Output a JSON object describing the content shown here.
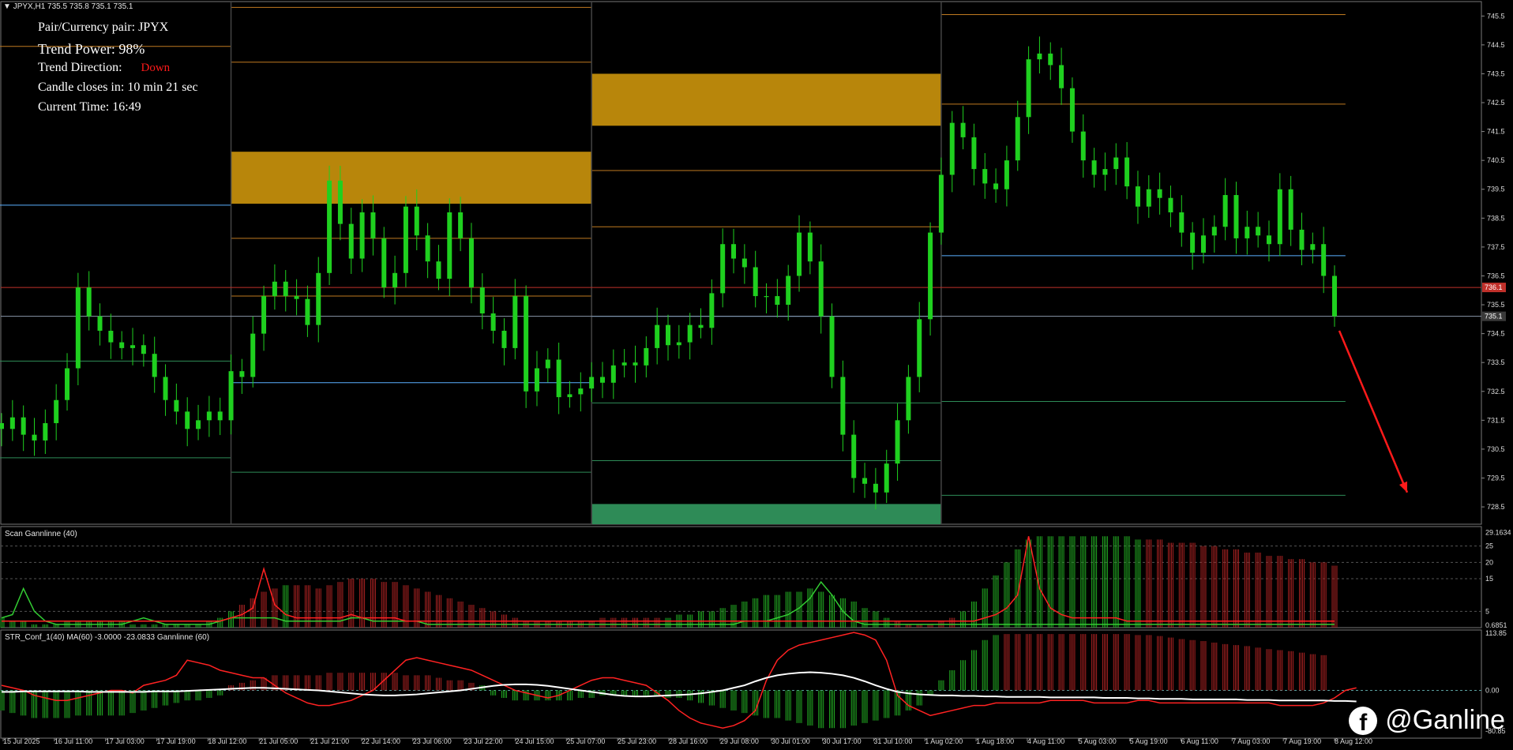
{
  "chart_header": {
    "symbol_line": "JPYX,H1  735.5 735.8 735.1 735.1",
    "scan_title": "Scan  Gannlinne (40)",
    "str_title": "STR_Conf_1(40) MA(60) -3.0000 -23.0833  Gannlinne (60)"
  },
  "info_panel": {
    "pair_label": "Pair/Currency pair: JPYX",
    "trend_power": "Trend Power: 98%",
    "trend_direction_label": "Trend Direction:",
    "trend_direction_value": "Down",
    "candle_close": "Candle closes in: 10 min 21 sec",
    "current_time": "Current Time: 16:49"
  },
  "brand": {
    "handle": "@Ganline",
    "icon": "facebook-icon"
  },
  "colors": {
    "candle": "#1fd01f",
    "zone": "#b8860b",
    "support_zone": "#2e8b57",
    "bull_hist": "#22aa22",
    "bear_hist": "#aa2222",
    "arrow": "#ff1a1a"
  },
  "chart_data": {
    "type": "candlestick",
    "main": {
      "y_ticks": [
        "745.5",
        "744.5",
        "743.5",
        "742.5",
        "741.5",
        "740.5",
        "739.5",
        "738.5",
        "737.5",
        "736.5",
        "735.5",
        "734.5",
        "733.5",
        "732.5",
        "731.5",
        "730.5",
        "729.5",
        "728.5"
      ],
      "ylim": [
        727.9,
        746.0
      ],
      "price_tags": [
        "736.1",
        "735.1"
      ],
      "last_price": 735.1,
      "ref_price": 736.1,
      "arrow_from": 734.6,
      "arrow_to": 729.0,
      "closes": [
        731.2,
        731.6,
        731.0,
        730.8,
        731.4,
        732.2,
        733.3,
        736.1,
        735.1,
        734.6,
        734.2,
        734.0,
        734.1,
        733.8,
        733.0,
        732.2,
        731.8,
        731.2,
        731.5,
        731.8,
        731.5,
        733.2,
        733.0,
        734.5,
        735.8,
        736.3,
        735.8,
        735.7,
        734.8,
        736.6,
        739.8,
        738.3,
        737.1,
        738.7,
        737.8,
        736.1,
        736.6,
        738.9,
        737.9,
        737.0,
        736.4,
        738.7,
        737.8,
        736.1,
        735.2,
        734.6,
        734.0,
        735.8,
        732.5,
        733.3,
        733.6,
        732.3,
        732.4,
        732.6,
        733.0,
        732.8,
        733.4,
        733.5,
        733.4,
        734.0,
        734.8,
        734.1,
        734.2,
        734.8,
        734.7,
        735.9,
        737.6,
        737.1,
        736.8,
        735.8,
        735.8,
        735.5,
        736.5,
        738.0,
        737.0,
        735.1,
        733.0,
        731.0,
        729.5,
        729.3,
        729.0,
        730.0,
        731.5,
        733.0,
        735.0,
        738.0,
        740.0,
        741.8,
        741.3,
        740.2,
        739.7,
        739.5,
        740.5,
        742.0,
        744.0,
        744.2,
        743.8,
        743.0,
        741.5,
        740.5,
        740.0,
        740.2,
        740.6,
        739.6,
        738.9,
        739.5,
        739.2,
        738.7,
        738.0,
        737.3,
        737.9,
        738.2,
        739.3,
        737.8,
        738.2,
        737.9,
        737.6,
        739.5,
        738.1,
        737.4,
        737.6,
        736.5,
        735.1
      ],
      "segments": [
        {
          "x0": 0,
          "x1": 21,
          "lines": [
            {
              "p": 744.45,
              "c": "#c07a20"
            },
            {
              "p": 738.95,
              "c": "#5ab0ff"
            },
            {
              "p": 733.55,
              "c": "#2e8b57"
            },
            {
              "p": 730.2,
              "c": "#2e8b57"
            }
          ]
        },
        {
          "x0": 21,
          "x1": 54,
          "zone": [
            739.0,
            740.8
          ],
          "lines": [
            {
              "p": 745.8,
              "c": "#c07a20"
            },
            {
              "p": 743.9,
              "c": "#c07a20"
            },
            {
              "p": 737.8,
              "c": "#c07a20"
            },
            {
              "p": 735.8,
              "c": "#c07a20"
            },
            {
              "p": 732.8,
              "c": "#5ab0ff"
            },
            {
              "p": 729.7,
              "c": "#2e8b57"
            }
          ]
        },
        {
          "x0": 54,
          "x1": 86,
          "zone": [
            741.7,
            743.5
          ],
          "support": [
            727.9,
            728.6
          ],
          "lines": [
            {
              "p": 740.15,
              "c": "#c07a20"
            },
            {
              "p": 738.2,
              "c": "#c07a20"
            },
            {
              "p": 735.1,
              "c": "#5ab0ff"
            },
            {
              "p": 732.1,
              "c": "#2e8b57"
            },
            {
              "p": 730.1,
              "c": "#2e8b57"
            }
          ]
        },
        {
          "x0": 86,
          "x1": 123,
          "lines": [
            {
              "p": 745.55,
              "c": "#c07a20"
            },
            {
              "p": 742.45,
              "c": "#c07a20"
            },
            {
              "p": 737.2,
              "c": "#5ab0ff"
            },
            {
              "p": 732.15,
              "c": "#2e8b57"
            },
            {
              "p": 728.9,
              "c": "#2e8b57"
            }
          ]
        }
      ]
    },
    "scan": {
      "y_ticks": [
        "29.1634",
        "25",
        "20",
        "15",
        "5",
        "0.6851"
      ],
      "ylim": [
        0,
        30
      ],
      "hist": [
        3,
        2,
        2,
        1,
        1,
        1,
        2,
        2,
        2,
        2,
        2,
        2,
        1,
        1,
        1,
        1,
        1,
        1,
        1,
        2,
        3,
        5,
        7,
        9,
        11,
        12,
        13,
        13,
        13,
        12,
        13,
        14,
        15,
        15,
        15,
        14,
        14,
        13,
        12,
        11,
        10,
        9,
        8,
        7,
        6,
        5,
        4,
        3,
        2,
        2,
        2,
        2,
        2,
        2,
        2,
        3,
        3,
        3,
        3,
        3,
        3,
        3,
        4,
        4,
        5,
        5,
        6,
        7,
        8,
        9,
        10,
        10,
        11,
        11,
        12,
        11,
        10,
        9,
        8,
        6,
        5,
        3,
        2,
        1,
        1,
        1,
        2,
        3,
        5,
        8,
        12,
        16,
        20,
        24,
        27,
        28,
        28,
        28,
        28,
        28,
        28,
        28,
        28,
        28,
        27,
        27,
        27,
        26,
        26,
        26,
        25,
        25,
        24,
        24,
        23,
        23,
        22,
        22,
        21,
        21,
        20,
        20,
        19
      ],
      "hist_colors": "ggggggggggggggggggggggrrrrgrrrrrrrrrrrrrrrrrrrrrrrrrrrrrrrrrrgggggggggggggggggggggrrrrrrgggggggggggggggggrrrrrrrrrrrrrrrrrrrrrrrrrrrrrrr",
      "green_line": [
        3,
        4,
        12,
        5,
        2,
        1,
        1,
        1,
        1,
        1,
        1,
        1,
        2,
        3,
        2,
        1,
        1,
        1,
        1,
        1,
        2,
        3,
        3,
        3,
        3,
        3,
        2,
        2,
        2,
        2,
        2,
        2,
        3,
        3,
        2,
        2,
        2,
        2,
        2,
        1,
        1,
        1,
        1,
        1,
        1,
        1,
        1,
        1,
        1,
        1,
        1,
        1,
        1,
        1,
        1,
        1,
        1,
        1,
        1,
        1,
        1,
        1,
        1,
        1,
        1,
        1,
        1,
        1,
        2,
        2,
        2,
        3,
        4,
        6,
        9,
        14,
        10,
        5,
        2,
        1,
        1,
        1,
        1,
        1,
        1,
        1,
        1,
        1,
        1,
        1,
        1,
        1,
        1,
        1,
        1,
        1,
        1,
        1,
        1,
        1,
        1,
        1,
        1,
        1,
        1,
        1,
        1,
        1,
        1,
        1,
        1,
        1,
        1,
        1,
        1,
        1,
        1,
        1,
        1,
        1,
        1,
        1,
        1
      ],
      "red_line": [
        2,
        2,
        2,
        2,
        2,
        2,
        2,
        2,
        2,
        2,
        2,
        2,
        2,
        2,
        2,
        2,
        2,
        2,
        2,
        2,
        2,
        3,
        4,
        6,
        18,
        7,
        4,
        3,
        3,
        3,
        3,
        3,
        4,
        3,
        3,
        3,
        3,
        2,
        2,
        2,
        2,
        2,
        2,
        2,
        2,
        2,
        2,
        2,
        2,
        2,
        2,
        2,
        2,
        2,
        2,
        2,
        2,
        2,
        2,
        2,
        2,
        2,
        2,
        2,
        2,
        2,
        2,
        2,
        2,
        2,
        2,
        2,
        2,
        2,
        2,
        2,
        2,
        2,
        2,
        2,
        2,
        2,
        2,
        2,
        2,
        2,
        2,
        2,
        2,
        2,
        3,
        4,
        6,
        10,
        28,
        12,
        6,
        4,
        3,
        3,
        3,
        3,
        3,
        2,
        2,
        2,
        2,
        2,
        2,
        2,
        2,
        2,
        2,
        2,
        2,
        2,
        2,
        2,
        2,
        2,
        2,
        2,
        2
      ]
    },
    "str": {
      "y_ticks": [
        "113.85",
        "0.00",
        "-80.85"
      ],
      "ylim": [
        -95,
        120
      ],
      "hist": [
        -40,
        -45,
        -50,
        -55,
        -55,
        -55,
        -55,
        -50,
        -50,
        -50,
        -50,
        -50,
        -45,
        -40,
        -35,
        -30,
        -25,
        -20,
        -20,
        -15,
        -10,
        10,
        15,
        20,
        25,
        30,
        30,
        30,
        30,
        30,
        35,
        35,
        35,
        35,
        35,
        35,
        35,
        30,
        30,
        30,
        25,
        20,
        20,
        15,
        10,
        -10,
        -15,
        -20,
        -20,
        -20,
        -20,
        -20,
        -20,
        -15,
        -15,
        -10,
        -10,
        -10,
        -10,
        -10,
        -10,
        -15,
        -15,
        -20,
        -25,
        -30,
        -35,
        -40,
        -45,
        -50,
        -55,
        -55,
        -60,
        -65,
        -70,
        -75,
        -75,
        -75,
        -70,
        -65,
        -60,
        -55,
        -50,
        -40,
        -30,
        -10,
        20,
        40,
        60,
        80,
        100,
        110,
        112,
        112,
        112,
        112,
        112,
        112,
        112,
        112,
        112,
        112,
        112,
        112,
        110,
        110,
        108,
        105,
        102,
        100,
        98,
        95,
        92,
        90,
        88,
        85,
        82,
        80,
        78,
        75,
        72,
        70
      ],
      "hist_colors": "gggggggggggggggggggggrrrrrrrrrrrrrrrrrrrrrrrggggggggggggggggggggggggggggggggggggggggggggggggrrrrrrrrrrrrrrrrrrrrrrrrrrrrrrrrrrrrr",
      "red_line": [
        10,
        5,
        0,
        -10,
        -15,
        -20,
        -20,
        -15,
        -10,
        -5,
        0,
        0,
        -5,
        10,
        15,
        20,
        30,
        60,
        55,
        50,
        40,
        35,
        30,
        25,
        25,
        10,
        -5,
        -15,
        -25,
        -30,
        -30,
        -25,
        -20,
        -10,
        0,
        20,
        40,
        60,
        65,
        60,
        55,
        50,
        45,
        40,
        30,
        20,
        10,
        0,
        -5,
        -10,
        -15,
        -10,
        0,
        10,
        20,
        25,
        25,
        20,
        15,
        10,
        -5,
        -20,
        -40,
        -55,
        -65,
        -70,
        -75,
        -70,
        -60,
        -40,
        20,
        60,
        80,
        90,
        95,
        100,
        105,
        110,
        115,
        110,
        100,
        60,
        -10,
        -30,
        -40,
        -50,
        -45,
        -40,
        -35,
        -30,
        -30,
        -25,
        -25,
        -25,
        -25,
        -25,
        -20,
        -20,
        -20,
        -20,
        -25,
        -25,
        -25,
        -25,
        -20,
        -20,
        -25,
        -25,
        -25,
        -25,
        -25,
        -25,
        -25,
        -25,
        -25,
        -25,
        -25,
        -30,
        -30,
        -30,
        -30,
        -25,
        -15,
        0,
        5
      ],
      "white_line": [
        -3,
        -3,
        -2,
        -2,
        -2,
        -2,
        -2,
        -2,
        -3,
        -3,
        -3,
        -3,
        -3,
        -3,
        -2,
        -2,
        -2,
        -1,
        0,
        1,
        2,
        3,
        4,
        5,
        5,
        4,
        3,
        2,
        1,
        0,
        -2,
        -4,
        -6,
        -8,
        -9,
        -10,
        -10,
        -9,
        -8,
        -6,
        -4,
        -2,
        0,
        3,
        6,
        9,
        11,
        12,
        12,
        11,
        9,
        6,
        3,
        0,
        -3,
        -6,
        -9,
        -11,
        -12,
        -12,
        -11,
        -10,
        -9,
        -8,
        -6,
        -3,
        0,
        5,
        10,
        18,
        25,
        30,
        33,
        35,
        36,
        35,
        33,
        30,
        25,
        18,
        10,
        3,
        -3,
        -6,
        -8,
        -9,
        -10,
        -10,
        -11,
        -11,
        -12,
        -12,
        -13,
        -13,
        -13,
        -13,
        -14,
        -14,
        -14,
        -14,
        -14,
        -15,
        -15,
        -15,
        -16,
        -16,
        -17,
        -17,
        -17,
        -18,
        -18,
        -18,
        -18,
        -18,
        -19,
        -19,
        -19,
        -20,
        -20,
        -20,
        -20,
        -20,
        -21,
        -21,
        -22
      ]
    },
    "x_ticks": [
      "15 Jul 2025",
      "16 Jul 11:00",
      "17 Jul 03:00",
      "17 Jul 19:00",
      "18 Jul 12:00",
      "21 Jul 05:00",
      "21 Jul 21:00",
      "22 Jul 14:00",
      "23 Jul 06:00",
      "23 Jul 22:00",
      "24 Jul 15:00",
      "25 Jul 07:00",
      "25 Jul 23:00",
      "28 Jul 16:00",
      "29 Jul 08:00",
      "30 Jul 01:00",
      "30 Jul 17:00",
      "31 Jul 10:00",
      "1 Aug 02:00",
      "1 Aug 18:00",
      "4 Aug 11:00",
      "5 Aug 03:00",
      "5 Aug 19:00",
      "6 Aug 11:00",
      "7 Aug 03:00",
      "7 Aug 19:00",
      "8 Aug 12:00"
    ]
  }
}
